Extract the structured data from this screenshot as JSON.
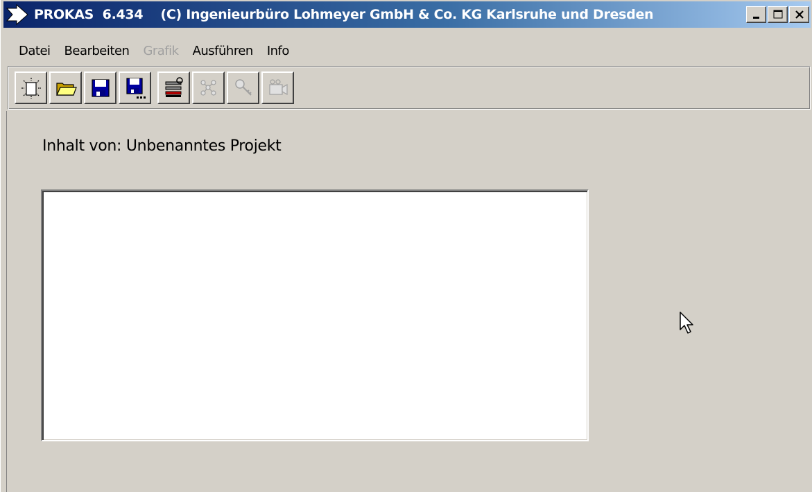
{
  "window": {
    "title": "PROKAS  6.434    (C) Ingenieurbüro Lohmeyer GmbH & Co. KG Karlsruhe und Dresden",
    "title_icon": "arrow-right-icon",
    "controls": [
      "minimize-icon",
      "maximize-icon",
      "close-icon"
    ]
  },
  "menu": {
    "items": [
      {
        "label": "Datei",
        "enabled": true
      },
      {
        "label": "Bearbeiten",
        "enabled": true
      },
      {
        "label": "Grafik",
        "enabled": false
      },
      {
        "label": "Ausführen",
        "enabled": true
      },
      {
        "label": "Info",
        "enabled": true
      }
    ]
  },
  "toolbar": {
    "buttons": [
      {
        "icon": "new-project-icon",
        "enabled": true
      },
      {
        "icon": "open-folder-icon",
        "enabled": true
      },
      {
        "icon": "save-icon",
        "enabled": true
      },
      {
        "icon": "save-as-icon",
        "enabled": true
      },
      {
        "icon": "settings-tools-icon",
        "enabled": true
      },
      {
        "icon": "network-icon",
        "enabled": false
      },
      {
        "icon": "key-icon",
        "enabled": false
      },
      {
        "icon": "camera-icon",
        "enabled": false
      }
    ]
  },
  "content": {
    "label": "Inhalt von: Unbenanntes Projekt",
    "listbox_items": []
  },
  "colors": {
    "titlebar_start": "#0a246a",
    "titlebar_end": "#a6caf0",
    "face": "#d4d0c8"
  }
}
